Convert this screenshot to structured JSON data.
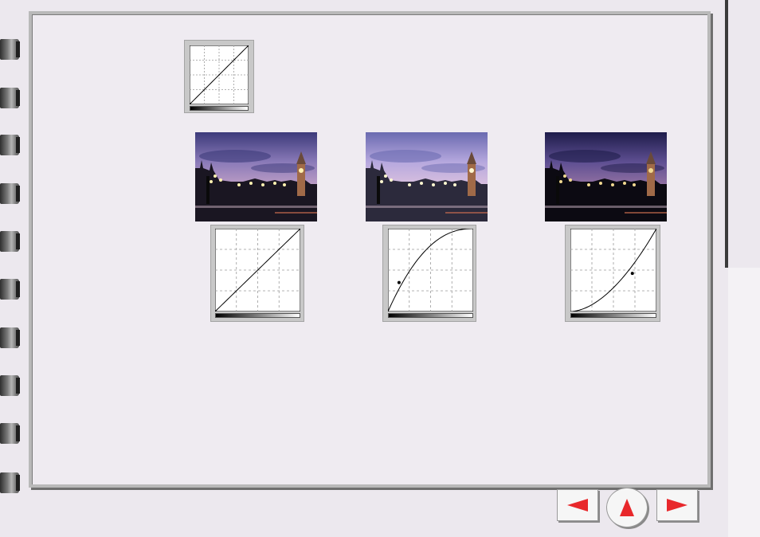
{
  "colors": {
    "page_background": "#ece8ee",
    "frame_border": "#b9b9b9",
    "nav_arrow": "#e8282b",
    "grid_line": "#9a9a9a",
    "curve_line": "#000000"
  },
  "legend_curve": {
    "type": "linear",
    "points": [
      [
        0,
        0
      ],
      [
        1,
        1
      ]
    ]
  },
  "examples": [
    {
      "photo": "big-ben-photo-normal",
      "curve_type": "linear",
      "control_point": null
    },
    {
      "photo": "big-ben-photo-brighter",
      "curve_type": "concave-brighten",
      "control_point": [
        0.13,
        0.35
      ]
    },
    {
      "photo": "big-ben-photo-darker",
      "curve_type": "convex-darken",
      "control_point": [
        0.72,
        0.46
      ]
    }
  ],
  "navigation": {
    "previous_icon": "left-triangle-icon",
    "home_icon": "up-triangle-icon",
    "next_icon": "right-triangle-icon"
  }
}
